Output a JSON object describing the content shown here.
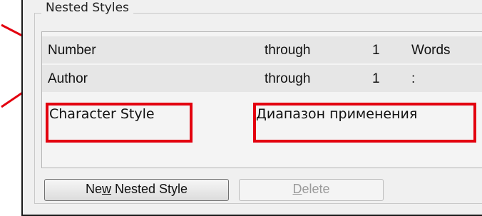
{
  "group": {
    "title": "Nested Styles"
  },
  "list": {
    "rows": [
      {
        "style": "Number",
        "mode": "through",
        "count": "1",
        "delimiter": "Words"
      },
      {
        "style": "Author",
        "mode": "through",
        "count": "1",
        "delimiter": ":"
      }
    ]
  },
  "annotations": {
    "character_style": "Character Style",
    "range": "Диапазон применения",
    "highlight_color": "#e3000f"
  },
  "buttons": {
    "new_prefix": "Ne",
    "new_mnemonic": "w",
    "new_suffix": " Nested Style",
    "delete_mnemonic": "D",
    "delete_suffix": "elete"
  }
}
